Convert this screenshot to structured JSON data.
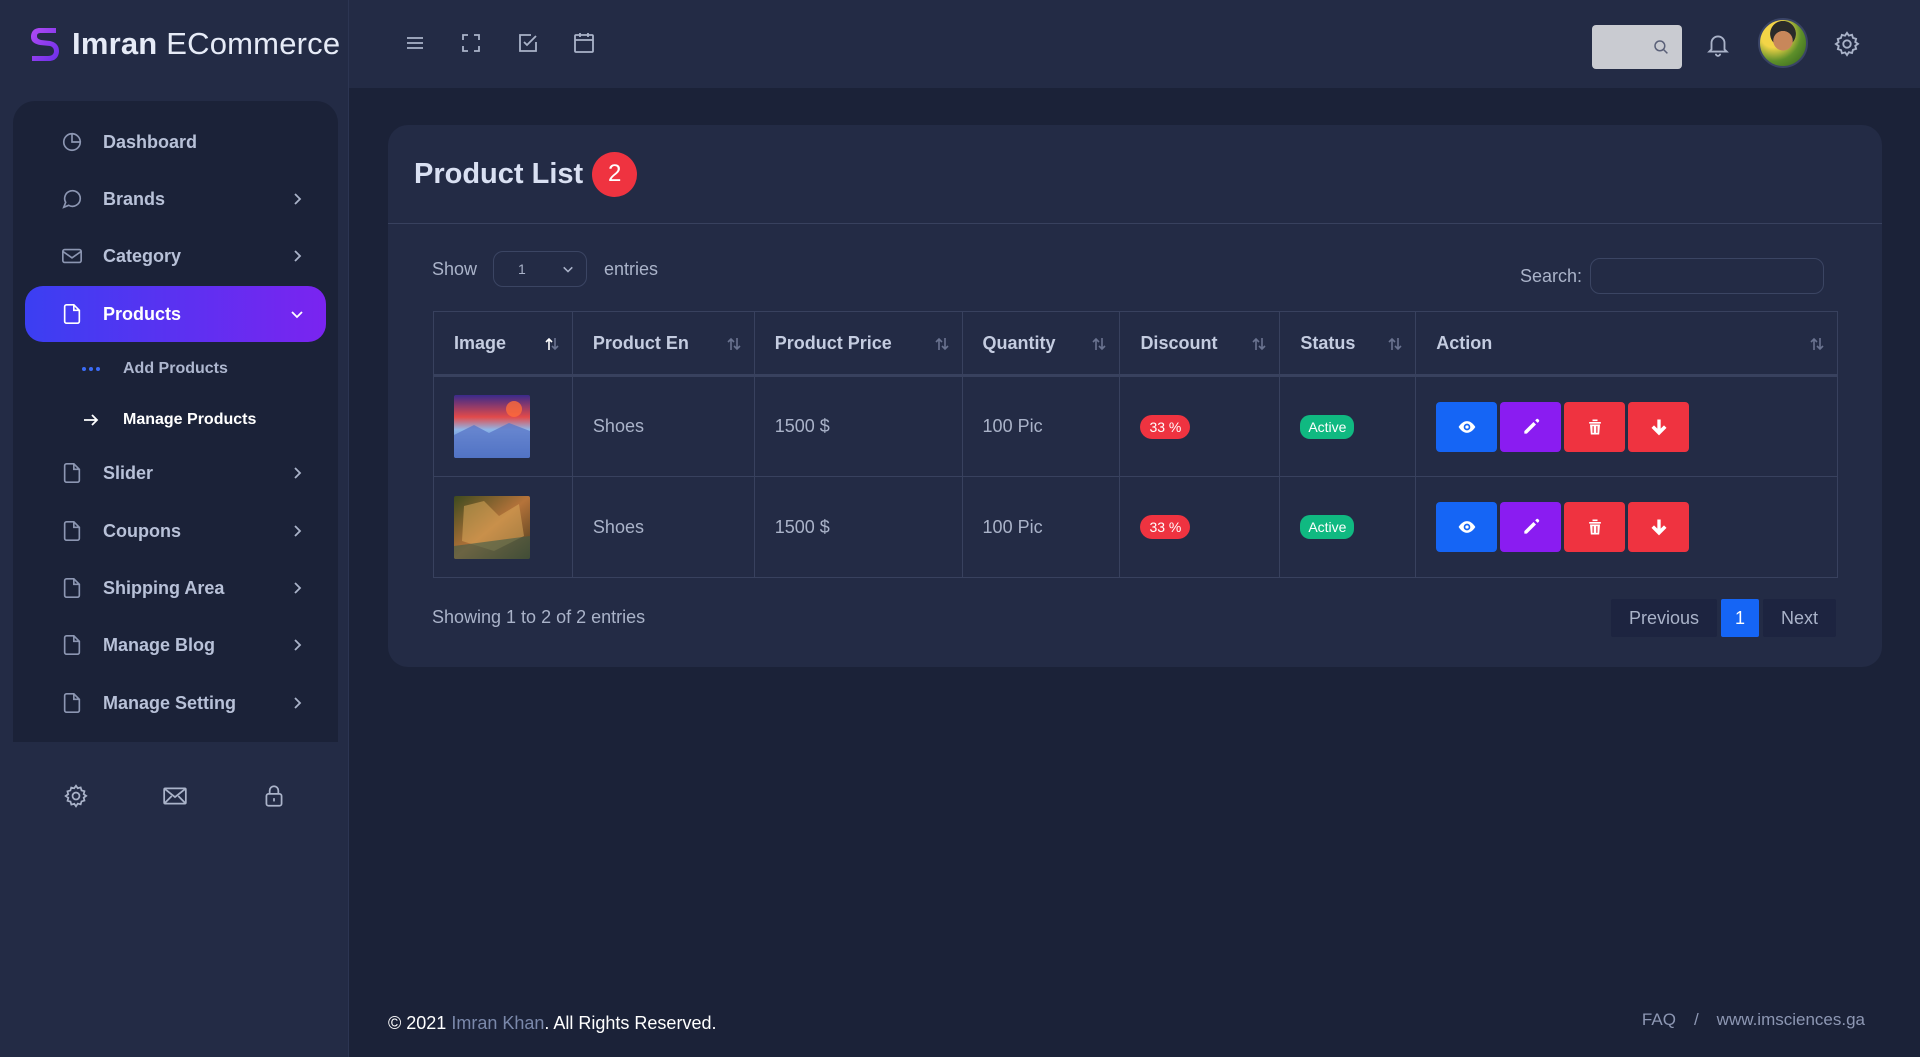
{
  "brand": {
    "name_bold": "Imran",
    "name_rest": "ECommerce"
  },
  "sidebar": {
    "items": [
      {
        "label": "Dashboard",
        "icon": "pie-chart-icon"
      },
      {
        "label": "Brands",
        "icon": "chat-icon"
      },
      {
        "label": "Category",
        "icon": "mail-icon"
      },
      {
        "label": "Products",
        "icon": "file-icon",
        "active": true
      },
      {
        "label": "Slider",
        "icon": "file-icon"
      },
      {
        "label": "Coupons",
        "icon": "file-icon"
      },
      {
        "label": "Shipping Area",
        "icon": "file-icon"
      },
      {
        "label": "Manage Blog",
        "icon": "file-icon"
      },
      {
        "label": "Manage Setting",
        "icon": "file-icon"
      }
    ],
    "submenu": [
      {
        "label": "Add Products",
        "icon": "dots-icon"
      },
      {
        "label": "Manage Products",
        "icon": "arrow-right-icon",
        "current": true
      }
    ],
    "bottom_icons": [
      "gear-icon",
      "mail-icon",
      "lock-icon"
    ]
  },
  "topbar": {
    "icons": [
      "menu-icon",
      "fullscreen-icon",
      "checkbox-icon",
      "calendar-icon",
      "search-icon",
      "bell-icon",
      "avatar",
      "gear-icon"
    ]
  },
  "card": {
    "title": "Product List",
    "count": "2",
    "show_label": "Show",
    "entries_value": "1",
    "entries_label": "entries",
    "search_label": "Search:",
    "columns": [
      "Image",
      "Product En",
      "Product Price",
      "Quantity",
      "Discount",
      "Status",
      "Action"
    ],
    "rows": [
      {
        "name": "Shoes",
        "price": "1500 $",
        "quantity": "100 Pic",
        "discount": "33 %",
        "status": "Active"
      },
      {
        "name": "Shoes",
        "price": "1500 $",
        "quantity": "100 Pic",
        "discount": "33 %",
        "status": "Active"
      }
    ],
    "info": "Showing 1 to 2 of 2 entries",
    "pager": {
      "previous": "Previous",
      "current": "1",
      "next": "Next"
    }
  },
  "footer": {
    "copyright_prefix": "© 2021",
    "author": "Imran Khan",
    "copyright_suffix": ". All Rights Reserved.",
    "faq": "FAQ",
    "separator": "/",
    "website": "www.imsciences.ga"
  },
  "colors": {
    "background": "#1b2238",
    "panel": "#232b45",
    "active_gradient_start": "#3b3ff2",
    "active_gradient_end": "#7a24f0",
    "danger": "#ef3340",
    "success": "#10b981",
    "primary": "#1565f5",
    "purple": "#8a1cf1"
  }
}
